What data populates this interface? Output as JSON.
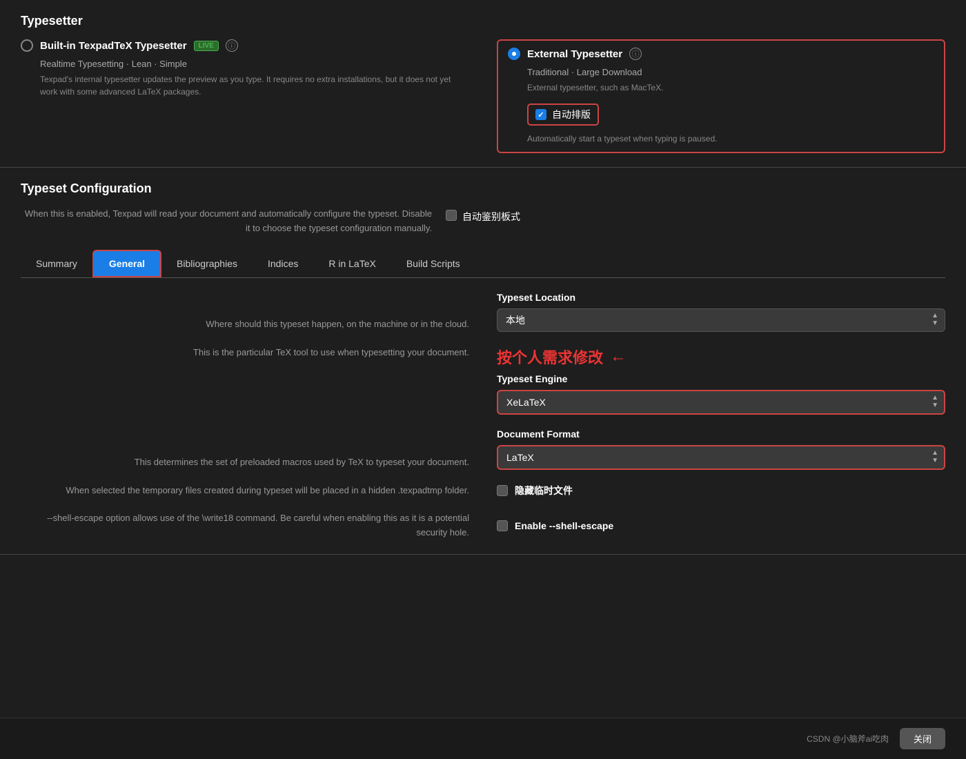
{
  "typesetter": {
    "title": "Typesetter",
    "builtin": {
      "label": "Built-in TexpadTeX Typesetter",
      "live_badge": "LIVE",
      "subtitle": "Realtime Typesetting · Lean · Simple",
      "desc": "Texpad's internal typesetter updates the preview as you type. It requires no extra installations, but it does not yet work with some advanced LaTeX packages.",
      "selected": false
    },
    "external": {
      "label": "External Typesetter",
      "subtitle": "Traditional · Large Download",
      "desc": "External typesetter, such as MacTeX.",
      "selected": true,
      "auto_label": "自动排版",
      "auto_desc": "Automatically start a typeset when typing is paused."
    }
  },
  "config": {
    "title": "Typeset Configuration",
    "auto_detect_desc": "When this is enabled, Texpad will read your document and automatically configure the typeset. Disable it to choose the typeset configuration manually.",
    "auto_detect_label": "自动鉴别板式",
    "tabs": [
      {
        "id": "summary",
        "label": "Summary"
      },
      {
        "id": "general",
        "label": "General",
        "active": true
      },
      {
        "id": "bibliographies",
        "label": "Bibliographies"
      },
      {
        "id": "indices",
        "label": "Indices"
      },
      {
        "id": "r_in_latex",
        "label": "R in LaTeX"
      },
      {
        "id": "build_scripts",
        "label": "Build Scripts"
      }
    ]
  },
  "general": {
    "typeset_location": {
      "label": "Typeset Location",
      "desc": "Where should this typeset happen, on the machine or in the cloud.",
      "value": "本地"
    },
    "typeset_engine": {
      "label": "Typeset Engine",
      "desc": "This is the particular TeX tool to use when typesetting your document.",
      "value": "XeLaTeX",
      "highlight": true
    },
    "document_format": {
      "label": "Document Format",
      "desc": "This determines the set of preloaded macros used by TeX to typeset your document.",
      "value": "LaTeX",
      "highlight": true
    },
    "hidden_files": {
      "label": "隐藏临时文件",
      "desc": "When selected the temporary files created during typeset will be placed in a hidden .texpadtmp folder."
    },
    "shell_escape": {
      "label": "Enable --shell-escape",
      "desc": "--shell-escape option allows use of the \\write18 command. Be careful when enabling this as it is a potential security hole."
    },
    "annotation": {
      "text": "按个人需求修改",
      "arrow": "←"
    }
  },
  "footer": {
    "credit": "CSDN @小脑斧ai吃肉",
    "close_label": "关闭"
  }
}
